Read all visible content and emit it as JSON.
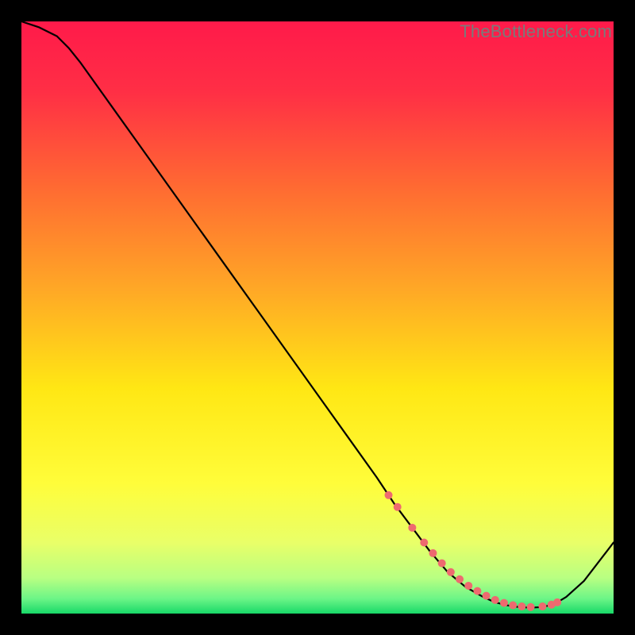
{
  "watermark": "TheBottleneck.com",
  "chart_data": {
    "type": "line",
    "title": "",
    "xlabel": "",
    "ylabel": "",
    "xlim": [
      0,
      100
    ],
    "ylim": [
      0,
      100
    ],
    "grid": false,
    "background_gradient": {
      "stops": [
        {
          "offset": 0.0,
          "color": "#ff1a4a"
        },
        {
          "offset": 0.12,
          "color": "#ff2f45"
        },
        {
          "offset": 0.28,
          "color": "#ff6a32"
        },
        {
          "offset": 0.45,
          "color": "#ffa726"
        },
        {
          "offset": 0.62,
          "color": "#ffe714"
        },
        {
          "offset": 0.78,
          "color": "#fffd3a"
        },
        {
          "offset": 0.88,
          "color": "#e9ff68"
        },
        {
          "offset": 0.94,
          "color": "#b8ff82"
        },
        {
          "offset": 0.975,
          "color": "#6cf587"
        },
        {
          "offset": 1.0,
          "color": "#18d968"
        }
      ]
    },
    "series": [
      {
        "name": "curve",
        "color": "#000000",
        "x": [
          0,
          3,
          6,
          8,
          10,
          15,
          20,
          25,
          30,
          35,
          40,
          45,
          50,
          55,
          60,
          63,
          66,
          69,
          72,
          75,
          78,
          80,
          82,
          84,
          86,
          88,
          90,
          92,
          95,
          100
        ],
        "y": [
          100,
          99,
          97.5,
          95.5,
          93,
          86,
          79,
          72,
          65,
          58,
          51,
          44,
          37,
          30,
          23,
          18.5,
          14.5,
          10.5,
          7,
          4.5,
          2.8,
          1.9,
          1.4,
          1.1,
          1.0,
          1.1,
          1.6,
          2.8,
          5.5,
          12
        ]
      }
    ],
    "markers": {
      "name": "dots",
      "color": "#ee6a6f",
      "radius_px": 5,
      "x": [
        62,
        63.5,
        66,
        68,
        69.5,
        71,
        72.5,
        74,
        75.5,
        77,
        78.5,
        80,
        81.5,
        83,
        84.5,
        86,
        88,
        89.5,
        90.5
      ],
      "y": [
        20,
        18,
        14.5,
        12,
        10.2,
        8.5,
        7,
        5.8,
        4.7,
        3.8,
        3.0,
        2.3,
        1.8,
        1.4,
        1.2,
        1.1,
        1.2,
        1.5,
        1.9
      ]
    }
  }
}
